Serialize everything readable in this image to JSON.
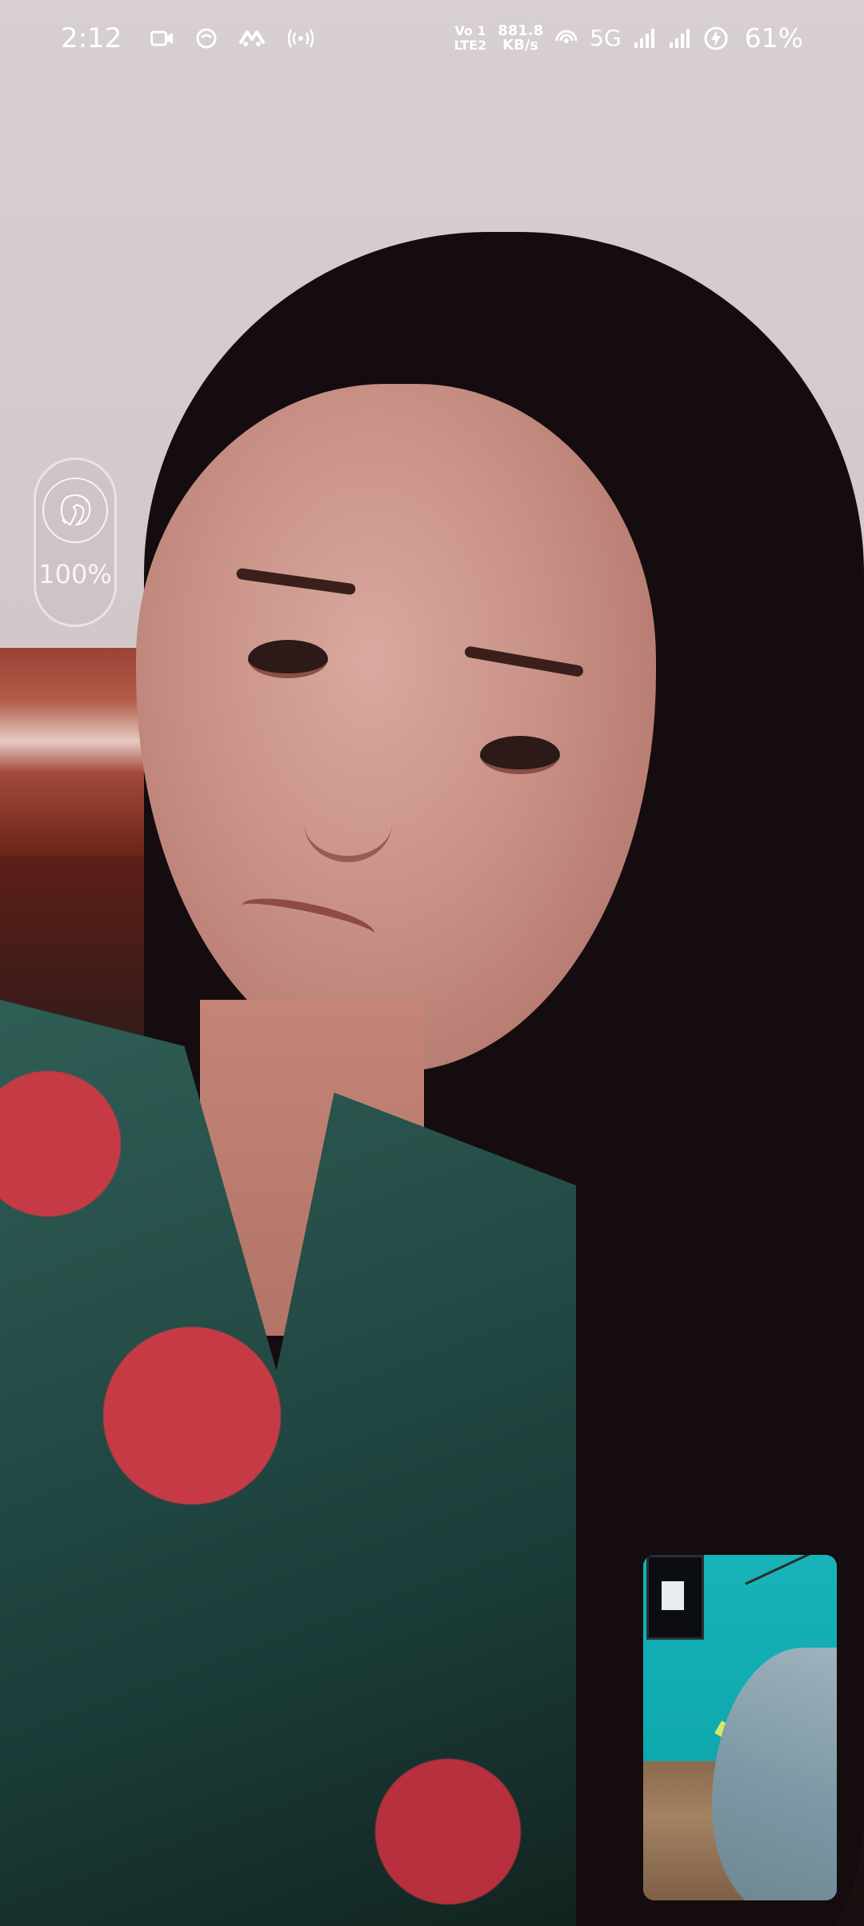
{
  "status_bar": {
    "time": "2:12",
    "volte_top": "Vo 1",
    "volte_bottom": "LTE2",
    "speed_value": "881.8",
    "speed_unit": "KB/s",
    "network": "5G",
    "battery": "61%",
    "left_icons": [
      "video-camera-icon",
      "app-icon",
      "app-icon-2",
      "hotspot-icon"
    ],
    "right_icons": [
      "volte-indicator",
      "hotspot-icon",
      "signal-icon",
      "battery-icon"
    ]
  },
  "beauty": {
    "icon": "beauty-face-icon",
    "value": "100%",
    "level": 1.0
  },
  "self_view": {
    "icon": "self-view-thumbnail"
  }
}
